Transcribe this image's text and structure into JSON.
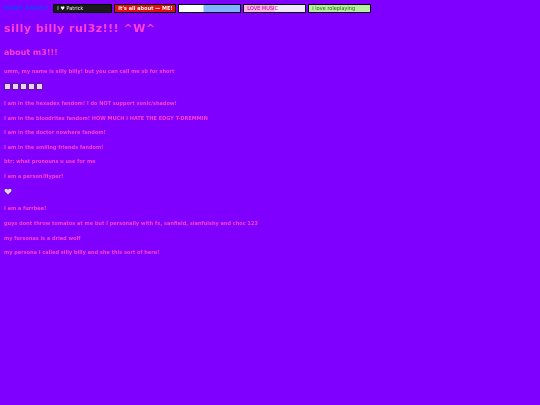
{
  "nav": {
    "home_label": "HOME PAGE!!",
    "blinkies": [
      "I ♥ Patrick",
      "it's all about — ME!",
      "",
      "LOVE MUSIC",
      "i love roleplaying"
    ]
  },
  "header": {
    "title": "silly billy rul3z!!! ^W^",
    "subtitle": "about m3!!!"
  },
  "about": {
    "intro": "umm, my name is silly billy! but you can call me sb for short",
    "lines": [
      "I am in the hexadex fandom! I do NOT support sonic/shadow!",
      "I am in the bloodrites fandom! HOW MUCH I HATE THE EDGY T-DREMMIN",
      "I am in the doctor nowhere fandom!",
      "I am in the smiling friends fandom!",
      "btr: what pronouns u use for me",
      "I am a person/Hyper!",
      "I am a furrbee!",
      "guys dont throw tomatos at me but I personally with fx, sanfield, sianfuishy and choc 123",
      "my fursonas is a dried wolf",
      "my persona I called silly billy and she this sort of here!"
    ]
  },
  "colors": {
    "background": "#8000ff",
    "text": "#ff40d0",
    "link": "#1e3cff"
  }
}
